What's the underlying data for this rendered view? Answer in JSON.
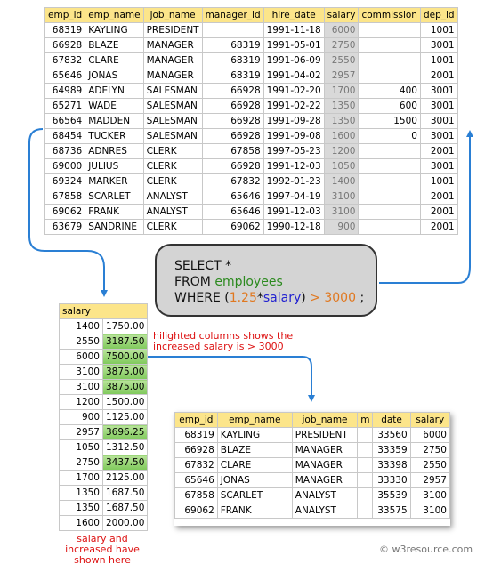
{
  "employees": {
    "columns": [
      "emp_id",
      "emp_name",
      "job_name",
      "manager_id",
      "hire_date",
      "salary",
      "commission",
      "dep_id"
    ],
    "rows": [
      [
        "68319",
        "KAYLING",
        "PRESIDENT",
        "",
        "1991-11-18",
        "6000",
        "",
        "1001"
      ],
      [
        "66928",
        "BLAZE",
        "MANAGER",
        "68319",
        "1991-05-01",
        "2750",
        "",
        "3001"
      ],
      [
        "67832",
        "CLARE",
        "MANAGER",
        "68319",
        "1991-06-09",
        "2550",
        "",
        "1001"
      ],
      [
        "65646",
        "JONAS",
        "MANAGER",
        "68319",
        "1991-04-02",
        "2957",
        "",
        "2001"
      ],
      [
        "64989",
        "ADELYN",
        "SALESMAN",
        "66928",
        "1991-02-20",
        "1700",
        "400",
        "3001"
      ],
      [
        "65271",
        "WADE",
        "SALESMAN",
        "66928",
        "1991-02-22",
        "1350",
        "600",
        "3001"
      ],
      [
        "66564",
        "MADDEN",
        "SALESMAN",
        "66928",
        "1991-09-28",
        "1350",
        "1500",
        "3001"
      ],
      [
        "68454",
        "TUCKER",
        "SALESMAN",
        "66928",
        "1991-09-08",
        "1600",
        "0",
        "3001"
      ],
      [
        "68736",
        "ADNRES",
        "CLERK",
        "67858",
        "1997-05-23",
        "1200",
        "",
        "2001"
      ],
      [
        "69000",
        "JULIUS",
        "CLERK",
        "66928",
        "1991-12-03",
        "1050",
        "",
        "3001"
      ],
      [
        "69324",
        "MARKER",
        "CLERK",
        "67832",
        "1992-01-23",
        "1400",
        "",
        "1001"
      ],
      [
        "67858",
        "SCARLET",
        "ANALYST",
        "65646",
        "1997-04-19",
        "3100",
        "",
        "2001"
      ],
      [
        "69062",
        "FRANK",
        "ANALYST",
        "65646",
        "1991-12-03",
        "3100",
        "",
        "2001"
      ],
      [
        "63679",
        "SANDRINE",
        "CLERK",
        "69062",
        "1990-12-18",
        "900",
        "",
        "2001"
      ]
    ]
  },
  "sql": {
    "line1": "SELECT *",
    "line2_kw": "FROM ",
    "line2_tbl": "employees",
    "line3_kw": "WHERE (",
    "line3_num": "1.25",
    "line3_star": "*",
    "line3_col": "salary",
    "line3_close": ") ",
    "line3_cmp": "> 3000",
    "line3_end": " ;"
  },
  "salary_table": {
    "header": "salary",
    "rows": [
      [
        "1400",
        "1750.00",
        false
      ],
      [
        "2550",
        "3187.50",
        true
      ],
      [
        "6000",
        "7500.00",
        true
      ],
      [
        "3100",
        "3875.00",
        true
      ],
      [
        "3100",
        "3875.00",
        true
      ],
      [
        "1200",
        "1500.00",
        false
      ],
      [
        "900",
        "1125.00",
        false
      ],
      [
        "2957",
        "3696.25",
        true
      ],
      [
        "1050",
        "1312.50",
        false
      ],
      [
        "2750",
        "3437.50",
        true
      ],
      [
        "1700",
        "2125.00",
        false
      ],
      [
        "1350",
        "1687.50",
        false
      ],
      [
        "1350",
        "1687.50",
        false
      ],
      [
        "1600",
        "2000.00",
        false
      ]
    ]
  },
  "result": {
    "columns": [
      "emp_id",
      "emp_name",
      "job_name",
      "m",
      "date",
      "salary"
    ],
    "rows": [
      [
        "68319",
        "KAYLING",
        "PRESIDENT",
        "33560",
        "6000"
      ],
      [
        "66928",
        "BLAZE",
        "MANAGER",
        "33359",
        "2750"
      ],
      [
        "67832",
        "CLARE",
        "MANAGER",
        "33398",
        "2550"
      ],
      [
        "65646",
        "JONAS",
        "MANAGER",
        "33330",
        "2957"
      ],
      [
        "67858",
        "SCARLET",
        "ANALYST",
        "35539",
        "3100"
      ],
      [
        "69062",
        "FRANK",
        "ANALYST",
        "33575",
        "3100"
      ]
    ]
  },
  "notes": {
    "highlight": "hilighted columns shows the increased salary is > 3000",
    "salary_shown": "salary and increased have shown here"
  },
  "credit": "© w3resource.com"
}
